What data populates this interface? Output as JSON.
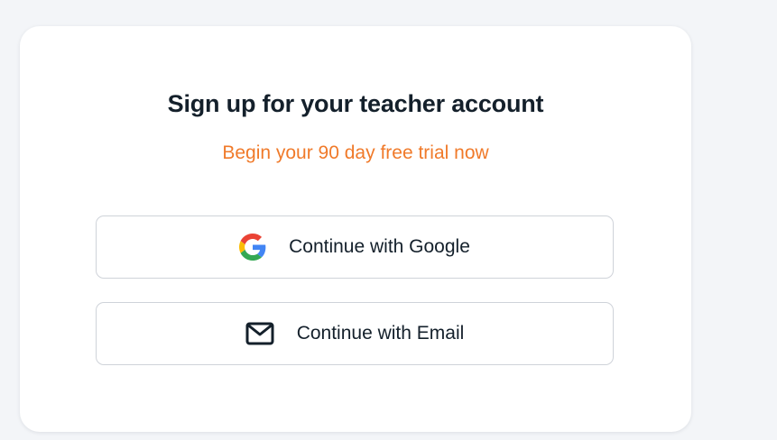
{
  "signup": {
    "title": "Sign up for your teacher account",
    "subtitle": "Begin your 90 day free trial now",
    "buttons": {
      "google": {
        "label": "Continue with Google",
        "icon": "google-logo-icon"
      },
      "email": {
        "label": "Continue with Email",
        "icon": "envelope-icon"
      }
    }
  },
  "colors": {
    "background": "#f3f5f8",
    "card": "#ffffff",
    "title": "#14202b",
    "accent": "#f07a2a",
    "button_border": "#cfd3d9"
  }
}
